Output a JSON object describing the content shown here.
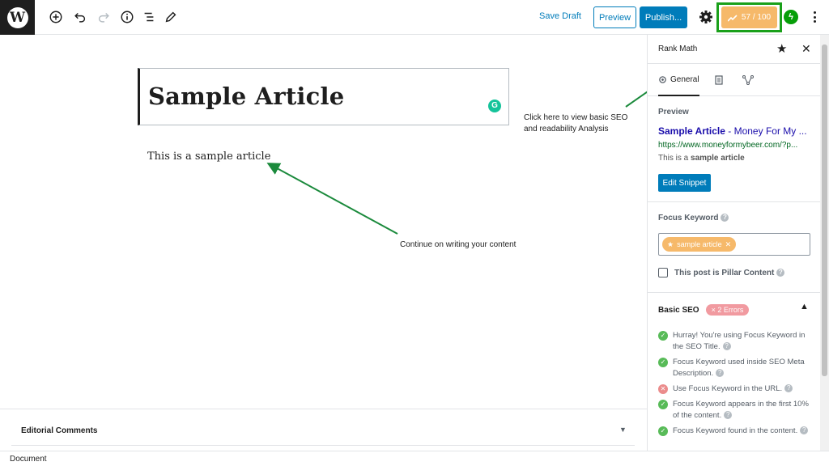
{
  "toolbar": {
    "logo": "W",
    "save_draft": "Save Draft",
    "preview": "Preview",
    "publish": "Publish...",
    "score": "57 / 100",
    "jetpack_icon": "jetpack-bolt-icon"
  },
  "editor": {
    "title": "Sample Article",
    "paragraph": "This is a sample article",
    "grammarly_icon": "grammarly-icon"
  },
  "annotations": {
    "seo_hint_line1": "Click here to view basic SEO",
    "seo_hint_line2": "and readability Analysis",
    "content_hint": "Continue on writing your content"
  },
  "panels": {
    "editorial_comments": "Editorial Comments"
  },
  "footer": {
    "breadcrumb": "Document"
  },
  "sidebar": {
    "title": "Rank Math",
    "tabs": [
      {
        "label": "General"
      }
    ],
    "preview": {
      "heading": "Preview",
      "title_bold": "Sample Article",
      "title_rest": " - Money For My ...",
      "url": "https://www.moneyformybeer.com/?p...",
      "desc_prefix": "This is a ",
      "desc_bold": "sample article",
      "edit_button": "Edit Snippet"
    },
    "focus_keyword": {
      "label": "Focus Keyword",
      "tag": "sample article"
    },
    "pillar": {
      "label": "This post is Pillar Content"
    },
    "basic_seo": {
      "title": "Basic SEO",
      "errors_badge": "× 2 Errors",
      "checks": [
        {
          "status": "pass",
          "text": "Hurray! You're using Focus Keyword in the SEO Title."
        },
        {
          "status": "pass",
          "text": "Focus Keyword used inside SEO Meta Description."
        },
        {
          "status": "fail",
          "text": "Use Focus Keyword in the URL."
        },
        {
          "status": "pass",
          "text": "Focus Keyword appears in the first 10% of the content."
        },
        {
          "status": "pass",
          "text": "Focus Keyword found in the content."
        }
      ]
    }
  },
  "colors": {
    "accent": "#007cba",
    "score_bg": "#f6b96a",
    "highlight_frame": "#1aa01a",
    "annotation_arrow": "#1b8a3c"
  }
}
